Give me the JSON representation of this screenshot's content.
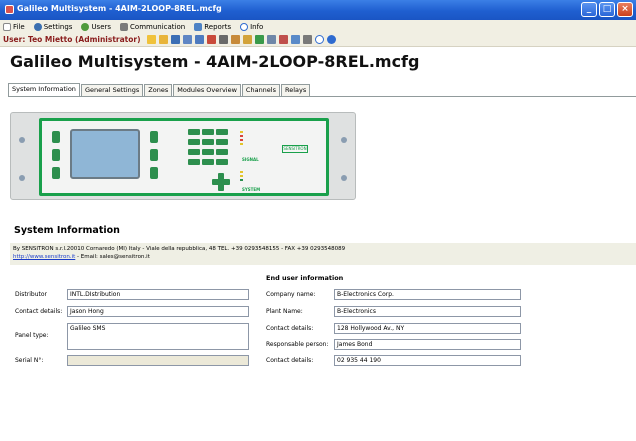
{
  "window": {
    "title": "Galileo Multisystem - 4AIM-2LOOP-8REL.mcfg"
  },
  "menu": [
    {
      "label": "File",
      "icon": "file-icon",
      "color": "#ffffff"
    },
    {
      "label": "Settings",
      "icon": "settings-icon",
      "color": "#3a6fb0"
    },
    {
      "label": "Users",
      "icon": "users-icon",
      "color": "#4f9a3c"
    },
    {
      "label": "Communication",
      "icon": "communication-icon",
      "color": "#7a7a7a"
    },
    {
      "label": "Reports",
      "icon": "reports-icon",
      "color": "#4e83c5"
    },
    {
      "label": "Info",
      "icon": "info-icon",
      "color": "#2f6bd0"
    }
  ],
  "userbar": {
    "label": "User: Teo Mietto (Administrator)",
    "toolbar_icons": [
      {
        "name": "new-icon",
        "color": "#f0c23a"
      },
      {
        "name": "open-icon",
        "color": "#e8b43a"
      },
      {
        "name": "save-icon",
        "color": "#3d6fb5"
      },
      {
        "name": "save-as-icon",
        "color": "#5f86c4"
      },
      {
        "name": "compare-icon",
        "color": "#4e7bbf"
      },
      {
        "name": "export-icon",
        "color": "#c94a3a"
      },
      {
        "name": "connect-icon",
        "color": "#6a6a6a"
      },
      {
        "name": "user-icon",
        "color": "#c78a3a"
      },
      {
        "name": "key-icon",
        "color": "#d3a33a"
      },
      {
        "name": "refresh-icon",
        "color": "#3a9a4a"
      },
      {
        "name": "grid-icon",
        "color": "#6f87a8"
      },
      {
        "name": "arrows-icon",
        "color": "#c0504d"
      },
      {
        "name": "chart-icon",
        "color": "#5a8ac8"
      },
      {
        "name": "print-icon",
        "color": "#7a7a7a"
      },
      {
        "name": "info-small-icon",
        "color": "#2f6bd0"
      },
      {
        "name": "help-icon",
        "color": "#2f6bd0"
      }
    ]
  },
  "app_title": "Galileo Multisystem - 4AIM-2LOOP-8REL.mcfg",
  "tabs": [
    "System Information",
    "General Settings",
    "Zones",
    "Modules Overview",
    "Channels",
    "Relays"
  ],
  "device": {
    "signal_label": "SIGNAL",
    "system_label": "SYSTEM",
    "logo": "SENSITRON"
  },
  "section": {
    "title": "System Information",
    "company_line": "By SENSITRON s.r.l.20010 Cornaredo (MI) Italy - Viale della repubblica, 48 TEL. +39 0293548155 - FAX +39 0293548089",
    "link": "http://www.sensitron.it",
    "email_text": " - Email: sales@sensitron.it"
  },
  "left_fields": [
    {
      "label": "Distributor",
      "value": "INTL.DIstribution"
    },
    {
      "label": "Contact details:",
      "value": "Jason Hong"
    },
    {
      "label": "Panel type:",
      "value": "Galileo SMS"
    },
    {
      "label": "Serial N°:",
      "value": ""
    }
  ],
  "end_user": {
    "title": "End user information",
    "fields": [
      {
        "label": "Company name:",
        "value": "B-Electronics Corp."
      },
      {
        "label": "Plant Name:",
        "value": "B-Electronics"
      },
      {
        "label": "Contact details:",
        "value": "128 Hollywood Av., NY"
      },
      {
        "label": "Responsable person:",
        "value": "James Bond"
      },
      {
        "label": "Contact details:",
        "value": "02 935 44 190"
      }
    ]
  }
}
